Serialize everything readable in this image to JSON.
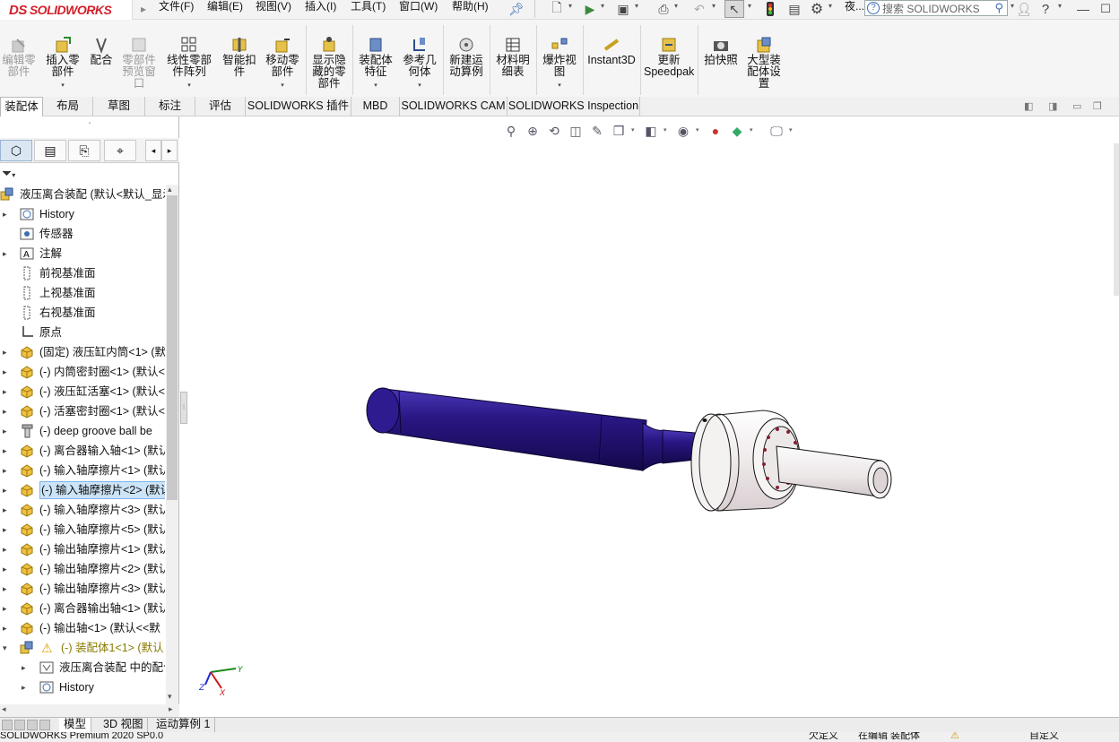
{
  "app": {
    "logo_text": "SOLIDWORKS",
    "logo_mark": "DS"
  },
  "menu": [
    {
      "label": "文件(F)"
    },
    {
      "label": "编辑(E)"
    },
    {
      "label": "视图(V)"
    },
    {
      "label": "插入(I)"
    },
    {
      "label": "工具(T)"
    },
    {
      "label": "窗口(W)"
    },
    {
      "label": "帮助(H)"
    }
  ],
  "topbar": {
    "search_placeholder": "搜索 SOLIDWORKS",
    "trunc_label": "夜..."
  },
  "ribbon": [
    {
      "label": "编辑零\n部件",
      "icon": "edit-component-icon",
      "disabled": true
    },
    {
      "label": "插入零\n部件",
      "icon": "insert-component-icon",
      "disabled": false,
      "dropdown": true
    },
    {
      "label": "配合",
      "icon": "mate-icon",
      "disabled": false
    },
    {
      "label": "零部件\n预览窗\n口",
      "icon": "component-preview-icon",
      "disabled": true
    },
    {
      "label": "线性零部\n件阵列",
      "icon": "linear-pattern-icon",
      "disabled": false,
      "dropdown": true
    },
    {
      "label": "智能扣\n件",
      "icon": "smart-fasteners-icon",
      "disabled": false
    },
    {
      "label": "移动零\n部件",
      "icon": "move-component-icon",
      "disabled": false,
      "dropdown": true
    },
    {
      "label": "显示隐\n藏的零\n部件",
      "icon": "show-hidden-icon",
      "disabled": false
    },
    {
      "label": "装配体\n特征",
      "icon": "assembly-features-icon",
      "disabled": false,
      "dropdown": true
    },
    {
      "label": "参考几\n何体",
      "icon": "reference-geometry-icon",
      "disabled": false,
      "dropdown": true
    },
    {
      "label": "新建运\n动算例",
      "icon": "motion-study-icon",
      "disabled": false
    },
    {
      "label": "材料明\n细表",
      "icon": "bom-icon",
      "disabled": false
    },
    {
      "label": "爆炸视\n图",
      "icon": "exploded-view-icon",
      "disabled": false,
      "dropdown": true
    },
    {
      "label": "Instant3D",
      "icon": "instant3d-icon",
      "disabled": false
    },
    {
      "label": "更新\nSpeedpak",
      "icon": "speedpak-icon",
      "disabled": false
    },
    {
      "label": "拍快照",
      "icon": "snapshot-icon",
      "disabled": false
    },
    {
      "label": "大型装\n配体设\n置",
      "icon": "large-assembly-icon",
      "disabled": false
    }
  ],
  "tabs": [
    {
      "label": "装配体",
      "active": true
    },
    {
      "label": "布局"
    },
    {
      "label": "草图"
    },
    {
      "label": "标注"
    },
    {
      "label": "评估"
    },
    {
      "label": "SOLIDWORKS 插件"
    },
    {
      "label": "MBD"
    },
    {
      "label": "SOLIDWORKS CAM"
    },
    {
      "label": "SOLIDWORKS Inspection"
    }
  ],
  "tree": [
    {
      "label": "液压离合装配  (默认<默认_显示",
      "icon": "assembly-icon",
      "arrow": "",
      "indent": 0
    },
    {
      "label": "History",
      "icon": "history-icon",
      "arrow": "▸",
      "indent": 1
    },
    {
      "label": "传感器",
      "icon": "sensor-icon",
      "arrow": "",
      "indent": 1
    },
    {
      "label": "注解",
      "icon": "annotation-icon",
      "arrow": "▸",
      "indent": 1
    },
    {
      "label": "前视基准面",
      "icon": "plane-icon",
      "arrow": "",
      "indent": 1
    },
    {
      "label": "上视基准面",
      "icon": "plane-icon",
      "arrow": "",
      "indent": 1
    },
    {
      "label": "右视基准面",
      "icon": "plane-icon",
      "arrow": "",
      "indent": 1
    },
    {
      "label": "原点",
      "icon": "origin-icon",
      "arrow": "",
      "indent": 1
    },
    {
      "label": "(固定) 液压缸内筒<1> (默",
      "icon": "part-icon",
      "arrow": "▸",
      "indent": 1
    },
    {
      "label": "(-) 内筒密封圈<1> (默认<",
      "icon": "part-icon",
      "arrow": "▸",
      "indent": 1
    },
    {
      "label": "(-) 液压缸活塞<1> (默认<",
      "icon": "part-icon",
      "arrow": "▸",
      "indent": 1
    },
    {
      "label": "(-) 活塞密封圈<1> (默认<",
      "icon": "part-icon",
      "arrow": "▸",
      "indent": 1
    },
    {
      "label": "(-) deep groove ball be",
      "icon": "toolbox-part-icon",
      "arrow": "▸",
      "indent": 1
    },
    {
      "label": "(-) 离合器输入轴<1> (默认",
      "icon": "part-icon",
      "arrow": "▸",
      "indent": 1
    },
    {
      "label": "(-) 输入轴摩擦片<1> (默认",
      "icon": "part-icon",
      "arrow": "▸",
      "indent": 1
    },
    {
      "label": "(-) 输入轴摩擦片<2> (默认",
      "icon": "part-icon",
      "arrow": "▸",
      "indent": 1,
      "selected": true
    },
    {
      "label": "(-) 输入轴摩擦片<3> (默认",
      "icon": "part-icon",
      "arrow": "▸",
      "indent": 1
    },
    {
      "label": "(-) 输入轴摩擦片<5> (默认",
      "icon": "part-icon",
      "arrow": "▸",
      "indent": 1
    },
    {
      "label": "(-) 输出轴摩擦片<1> (默认",
      "icon": "part-icon",
      "arrow": "▸",
      "indent": 1
    },
    {
      "label": "(-) 输出轴摩擦片<2> (默认",
      "icon": "part-icon",
      "arrow": "▸",
      "indent": 1
    },
    {
      "label": "(-) 输出轴摩擦片<3> (默认",
      "icon": "part-icon",
      "arrow": "▸",
      "indent": 1
    },
    {
      "label": "(-) 离合器输出轴<1> (默认",
      "icon": "part-icon",
      "arrow": "▸",
      "indent": 1
    },
    {
      "label": "(-) 输出轴<1> (默认<<默",
      "icon": "part-icon",
      "arrow": "▸",
      "indent": 1
    },
    {
      "label": "(-) 装配体1<1> (默认",
      "icon": "subassembly-icon",
      "arrow": "▾",
      "indent": 1,
      "warning": true
    },
    {
      "label": "液压离合装配 中的配合",
      "icon": "mates-folder-icon",
      "arrow": "▸",
      "indent": 2
    },
    {
      "label": "History",
      "icon": "history-icon",
      "arrow": "▸",
      "indent": 2
    }
  ],
  "bottom_tabs": [
    {
      "label": "模型",
      "active": true
    },
    {
      "label": "3D 视图"
    },
    {
      "label": "运动算例 1"
    }
  ],
  "status": {
    "left": "SOLIDWORKS Premium 2020 SP0.0",
    "s1": "欠定义",
    "s2": "在编辑 装配体",
    "s3": "自定义"
  },
  "colors": {
    "shaft_blue": "#2a1784",
    "hub_white": "#f2eeee",
    "accent": "#d31f2a",
    "selection": "#cce4f7"
  }
}
